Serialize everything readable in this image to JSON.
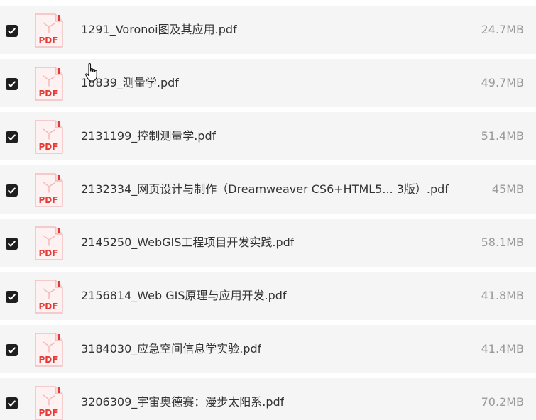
{
  "colors": {
    "row_background": "#f5f5f5",
    "checkbox": "#1f1f1f",
    "pdf_red": "#e53935",
    "name_text": "#333333",
    "size_text": "#999999"
  },
  "icons": {
    "file_icon": "pdf-file-icon",
    "checkbox": "checkbox-checked-icon",
    "cursor": "hand-pointer-cursor"
  },
  "files": [
    {
      "name": "1291_Voronoi图及其应用.pdf",
      "size": "24.7MB",
      "checked": true,
      "icon_label": "PDF"
    },
    {
      "name": "18839_测量学.pdf",
      "size": "49.7MB",
      "checked": true,
      "icon_label": "PDF"
    },
    {
      "name": "2131199_控制测量学.pdf",
      "size": "51.4MB",
      "checked": true,
      "icon_label": "PDF"
    },
    {
      "name": "2132334_网页设计与制作（Dreamweaver CS6+HTML5... 3版）.pdf",
      "size": "45MB",
      "checked": true,
      "icon_label": "PDF"
    },
    {
      "name": "2145250_WebGIS工程项目开发实践.pdf",
      "size": "58.1MB",
      "checked": true,
      "icon_label": "PDF"
    },
    {
      "name": "2156814_Web GIS原理与应用开发.pdf",
      "size": "41.8MB",
      "checked": true,
      "icon_label": "PDF"
    },
    {
      "name": "3184030_应急空间信息学实验.pdf",
      "size": "41.4MB",
      "checked": true,
      "icon_label": "PDF"
    },
    {
      "name": "3206309_宇宙奥德赛：漫步太阳系.pdf",
      "size": "70.2MB",
      "checked": true,
      "icon_label": "PDF"
    }
  ]
}
